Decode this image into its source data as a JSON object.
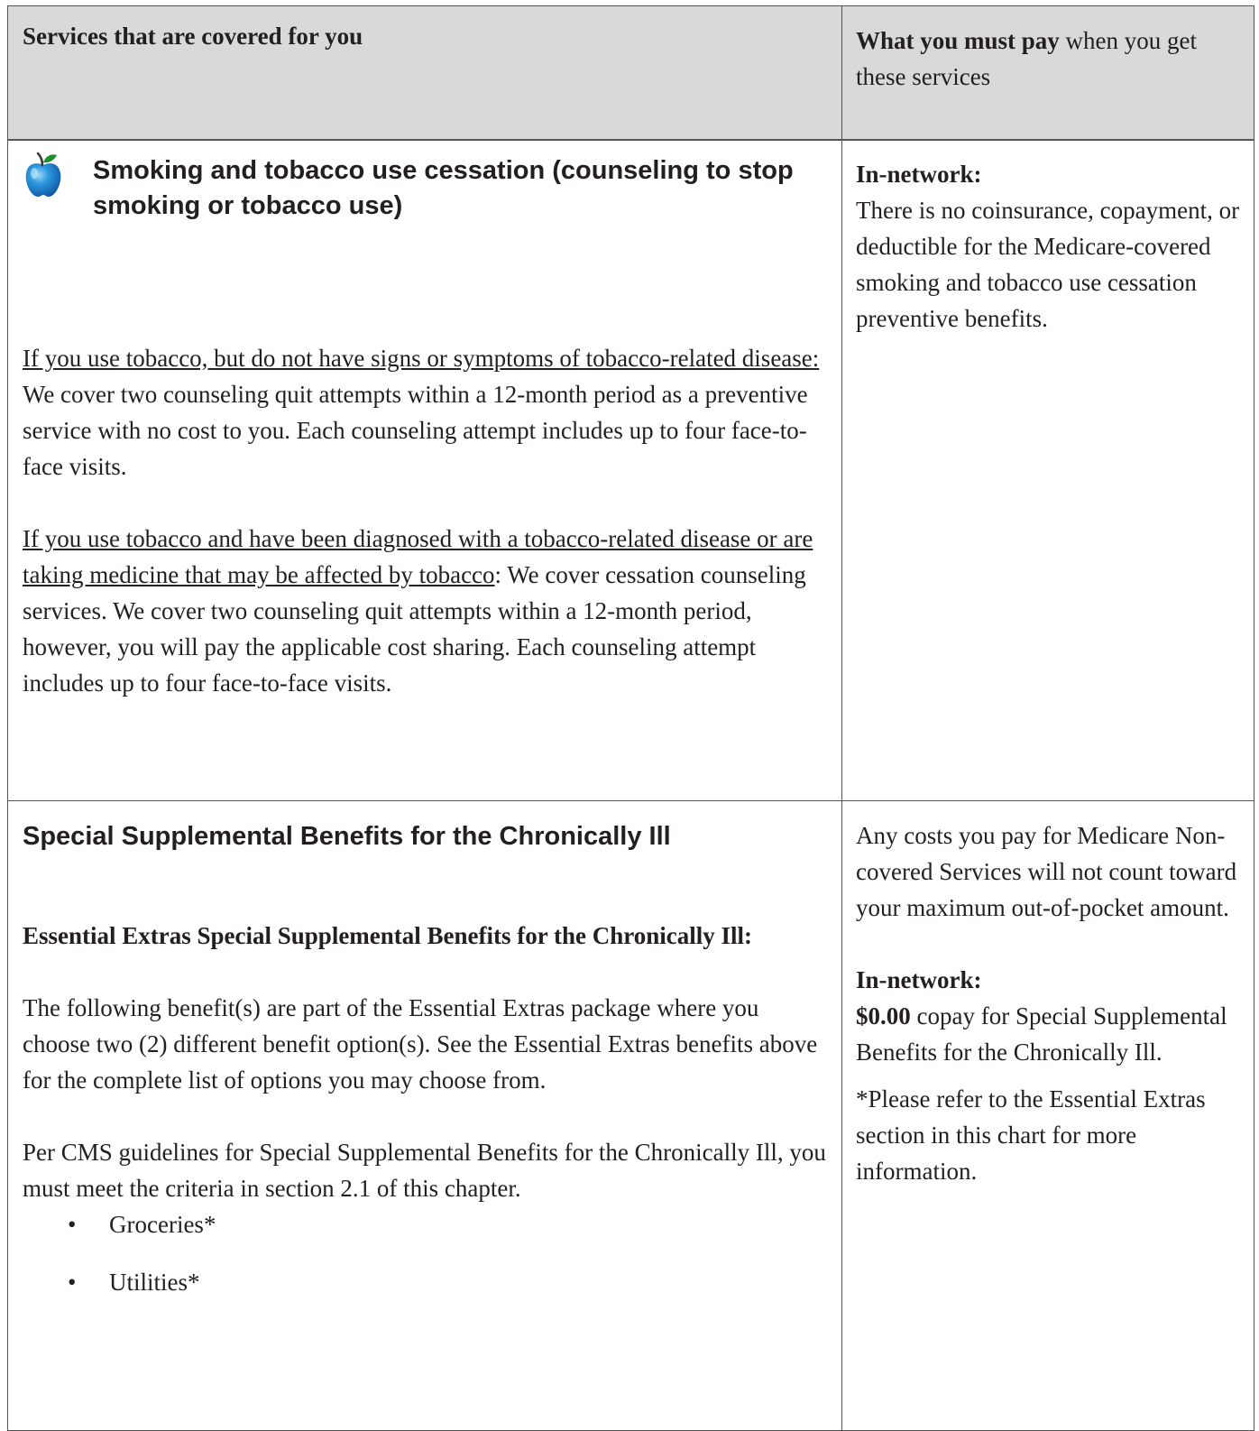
{
  "header": {
    "left": "Services that are covered for you",
    "right_bold": "What you must pay",
    "right_rest": " when you get these services"
  },
  "row1": {
    "icon": "apple-icon",
    "title": "Smoking and tobacco use cessation (counseling to stop smoking or tobacco use)",
    "para1_underline": "If you use tobacco, but do not have signs or symptoms of tobacco-related disease:",
    "para1_rest": " We cover two counseling quit attempts within a 12-month period as a preventive service with no cost to you. Each counseling attempt includes up to four face-to-face visits.",
    "para2_underline": "If you use tobacco and have been diagnosed with a tobacco-related disease or are taking medicine that may be affected by tobacco",
    "para2_rest": ": We cover cessation counseling services. We cover two counseling quit attempts within a 12-month period, however, you will pay the applicable cost sharing. Each counseling attempt includes up to four face-to-face visits.",
    "right_label": "In-network:",
    "right_text": "There is no coinsurance, copayment, or deductible for the Medicare-covered smoking and tobacco use cessation preventive benefits."
  },
  "row2": {
    "title": "Special Supplemental Benefits for the Chronically Ill",
    "subtitle": "Essential Extras Special Supplemental Benefits for the Chronically Ill:",
    "para1": "The following benefit(s) are part of the Essential Extras package where you choose two (2) different benefit option(s). See the Essential Extras benefits above for the complete list of options you may choose from.",
    "para2": "Per CMS guidelines for Special Supplemental Benefits for the Chronically Ill, you must meet the criteria in section 2.1 of this chapter.",
    "bullet_char": "•",
    "items": [
      "Groceries*",
      "Utilities*"
    ],
    "right_para1": "Any costs you pay for Medicare Non-covered Services will not count toward your maximum out-of-pocket amount.",
    "right_label": "In-network:",
    "right_amount": "$0.00",
    "right_amount_rest": " copay for Special Supplemental Benefits for the Chronically Ill.",
    "right_note": "*Please refer to the Essential Extras section in this chart for more information."
  }
}
